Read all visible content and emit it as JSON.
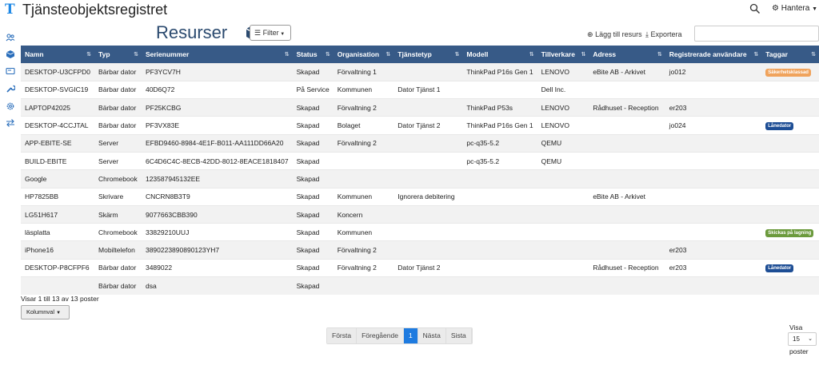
{
  "app": {
    "logo_letter": "T",
    "title": "Tjänsteobjektsregistret"
  },
  "topbar": {
    "search_icon": "search-icon",
    "manage_label": "Hantera",
    "manage_icon": "gear-icon"
  },
  "sidebar": {
    "icons": [
      "users-icon",
      "box-icon",
      "card-icon",
      "wrench-icon",
      "gear-icon",
      "arrows-icon"
    ]
  },
  "resources": {
    "title": "Resurser",
    "filter_label": "Filter",
    "add_label": "Lägg till resurs",
    "export_label": "Exportera",
    "search_value": ""
  },
  "table": {
    "columns": [
      "Namn",
      "Typ",
      "Serienummer",
      "Status",
      "Organisation",
      "Tjänstetyp",
      "Modell",
      "Tillverkare",
      "Adress",
      "Registrerade användare",
      "Taggar"
    ],
    "rows": [
      {
        "c": [
          "DESKTOP-U3CFPD0",
          "Bärbar dator",
          "PF3YCV7H",
          "Skapad",
          "Förvaltning 1",
          "",
          "ThinkPad P16s Gen 1",
          "LENOVO",
          "eBite AB - Arkivet",
          "jo012"
        ],
        "tag": "Säkerhetsklassad",
        "tag_color": "#f0a35c"
      },
      {
        "c": [
          "DESKTOP-SVGIC19",
          "Bärbar dator",
          "40D6Q72",
          "På Service",
          "Kommunen",
          "Dator Tjänst 1",
          "",
          "Dell Inc.",
          "",
          ""
        ],
        "tag": "",
        "tag_color": ""
      },
      {
        "c": [
          "LAPTOP42025",
          "Bärbar dator",
          "PF25KCBG",
          "Skapad",
          "Förvaltning 2",
          "",
          "ThinkPad P53s",
          "LENOVO",
          "Rådhuset - Reception",
          "er203"
        ],
        "tag": "",
        "tag_color": ""
      },
      {
        "c": [
          "DESKTOP-4CCJTAL",
          "Bärbar dator",
          "PF3VX83E",
          "Skapad",
          "Bolaget",
          "Dator Tjänst 2",
          "ThinkPad P16s Gen 1",
          "LENOVO",
          "",
          "jo024"
        ],
        "tag": "Lånedator",
        "tag_color": "#1e4e95"
      },
      {
        "c": [
          "APP-EBITE-SE",
          "Server",
          "EFBD9460-8984-4E1F-B011-AA111DD66A20",
          "Skapad",
          "Förvaltning 2",
          "",
          "pc-q35-5.2",
          "QEMU",
          "",
          ""
        ],
        "tag": "",
        "tag_color": ""
      },
      {
        "c": [
          "BUILD-EBITE",
          "Server",
          "6C4D6C4C-8ECB-42DD-8012-8EACE1818407",
          "Skapad",
          "",
          "",
          "pc-q35-5.2",
          "QEMU",
          "",
          ""
        ],
        "tag": "",
        "tag_color": ""
      },
      {
        "c": [
          "Google",
          "Chromebook",
          "123587945132EE",
          "Skapad",
          "",
          "",
          "",
          "",
          "",
          ""
        ],
        "tag": "",
        "tag_color": ""
      },
      {
        "c": [
          "HP7825BB",
          "Skrivare",
          "CNCRN8B3T9",
          "Skapad",
          "Kommunen",
          "Ignorera debitering",
          "",
          "",
          "eBite AB - Arkivet",
          ""
        ],
        "tag": "",
        "tag_color": ""
      },
      {
        "c": [
          "LG51H617",
          "Skärm",
          "9077663CBB390",
          "Skapad",
          "Koncern",
          "",
          "",
          "",
          "",
          ""
        ],
        "tag": "",
        "tag_color": ""
      },
      {
        "c": [
          "läsplatta",
          "Chromebook",
          "33829210UUJ",
          "Skapad",
          "Kommunen",
          "",
          "",
          "",
          "",
          ""
        ],
        "tag": "Skickas på lagning",
        "tag_color": "#6b9a3c"
      },
      {
        "c": [
          "iPhone16",
          "Mobiltelefon",
          "3890223890890123YH7",
          "Skapad",
          "Förvaltning 2",
          "",
          "",
          "",
          "",
          "er203"
        ],
        "tag": "",
        "tag_color": ""
      },
      {
        "c": [
          "DESKTOP-P8CFPF6",
          "Bärbar dator",
          "3489022",
          "Skapad",
          "Förvaltning 2",
          "Dator Tjänst 2",
          "",
          "",
          "Rådhuset - Reception",
          "er203"
        ],
        "tag": "Lånedator",
        "tag_color": "#1e4e95"
      },
      {
        "c": [
          "",
          "Bärbar dator",
          "dsa",
          "Skapad",
          "",
          "",
          "",
          "",
          "",
          ""
        ],
        "tag": "",
        "tag_color": ""
      }
    ]
  },
  "footer": {
    "info": "Visar 1 till 13 av 13 poster",
    "column_choice_label": "Kolumnval",
    "pagination": {
      "first": "Första",
      "prev": "Föregående",
      "current": "1",
      "next": "Nästa",
      "last": "Sista"
    },
    "page_size_label_top": "Visa",
    "page_size": "15",
    "page_size_label_bottom": "poster"
  }
}
